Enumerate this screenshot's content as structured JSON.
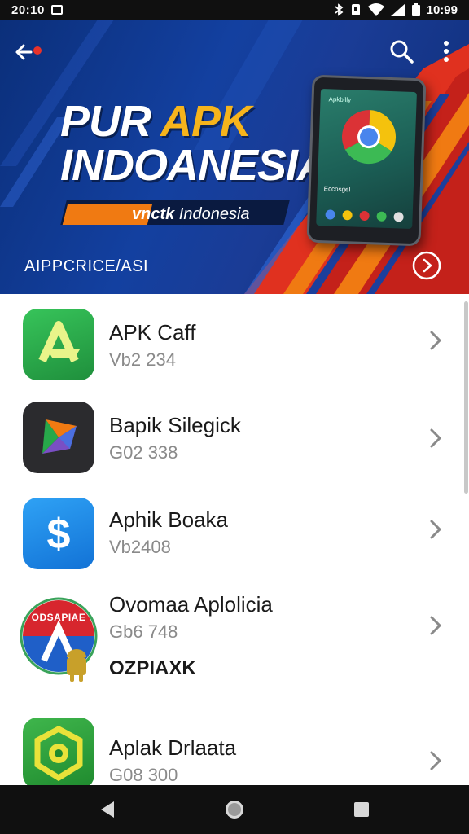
{
  "status_bar": {
    "time": "20:10",
    "clock": "10:99"
  },
  "header": {
    "title_line1_part1": "PUR ",
    "title_line1_accent": "APK",
    "title_line2": "INDOANESIA",
    "ribbon_bold": "vnctk",
    "ribbon_text": " Indonesia",
    "caption": "AIPPCRICE/ASI",
    "phone_screen_title": "Apkbilly",
    "phone_screen_label": "Eccosgel"
  },
  "apps": [
    {
      "name": "APK Caff",
      "version": "Vb2 234",
      "icon": "apk-caff-icon",
      "color": "#27a84a"
    },
    {
      "name": "Bapik Silegick",
      "version": "G02 338",
      "icon": "bapik-silegick-icon",
      "color": "#2b2b2e"
    },
    {
      "name": "Aphik Boaka",
      "version": "Vb2408",
      "icon": "aphik-boaka-icon",
      "color": "#1e8be8"
    },
    {
      "name": "Ovomaa Aplolicia",
      "version": "Gb6 748",
      "extra": "OZPIAXK",
      "icon": "ovomaa-aplolicia-icon",
      "badge": "ODSAPIAE",
      "color": "#d7262e"
    },
    {
      "name": "Aplak Drlaata",
      "version": "G08 300",
      "icon": "aplak-drlaata-icon",
      "color": "#2e9e3a"
    }
  ],
  "colors": {
    "banner_blue": "#1340a0",
    "accent_orange": "#f07a12",
    "accent_yellow": "#f6b41c"
  },
  "icons": {
    "back": "back-arrow-icon",
    "search": "search-icon",
    "more": "more-vert-icon",
    "play": "play-circle-icon",
    "chevron": "chevron-right-icon",
    "nav_back": "nav-back-icon",
    "nav_home": "nav-home-icon",
    "nav_recents": "nav-recents-icon"
  }
}
